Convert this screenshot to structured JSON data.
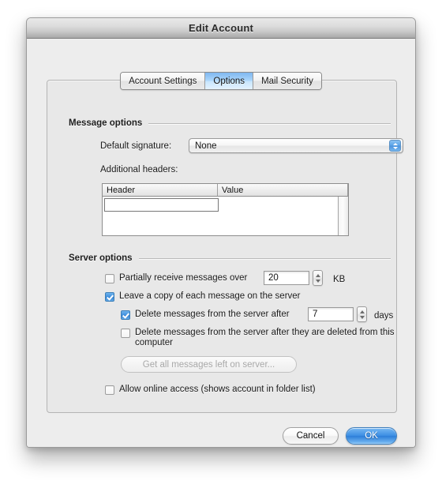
{
  "window": {
    "title": "Edit Account"
  },
  "tabs": [
    {
      "label": "Account Settings",
      "selected": false
    },
    {
      "label": "Options",
      "selected": true
    },
    {
      "label": "Mail Security",
      "selected": false
    }
  ],
  "message_options": {
    "group_title": "Message options",
    "default_signature_label": "Default signature:",
    "default_signature_value": "None",
    "additional_headers_label": "Additional headers:",
    "table": {
      "columns": [
        "Header",
        "Value"
      ],
      "rows": [],
      "editing_cell_value": ""
    }
  },
  "server_options": {
    "group_title": "Server options",
    "partially_receive": {
      "label": "Partially receive messages over",
      "checked": false,
      "value": "20",
      "unit": "KB"
    },
    "leave_copy": {
      "label": "Leave a copy of each message on the server",
      "checked": true
    },
    "delete_after": {
      "label": "Delete messages from the server after",
      "checked": true,
      "value": "7",
      "unit": "days"
    },
    "delete_when_deleted": {
      "label": "Delete messages from the server after they are deleted from this computer",
      "checked": false
    },
    "get_all_messages_button": {
      "label": "Get all messages left on server...",
      "enabled": false
    },
    "allow_online_access": {
      "label": "Allow online access (shows account in folder list)",
      "checked": false
    }
  },
  "footer": {
    "cancel_label": "Cancel",
    "ok_label": "OK"
  },
  "colors": {
    "accent_blue": "#2d7ed9",
    "selected_tab": "#7fb8f0",
    "window_bg": "#ededed",
    "panel_bg": "#e8e8e8"
  }
}
